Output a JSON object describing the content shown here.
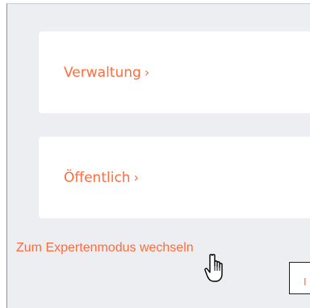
{
  "cards": {
    "admin_label": "Verwaltung",
    "public_label": "Öffentlich"
  },
  "expert_mode_link": "Zum Expertenmodus wechseln",
  "tooltip_fragment": "I",
  "icons": {
    "chevron": "chevron-right-icon",
    "cursor": "hand-pointer-cursor-icon"
  },
  "colors": {
    "accent": "#ff6b3d",
    "background": "#eceef2",
    "card": "#ffffff"
  }
}
